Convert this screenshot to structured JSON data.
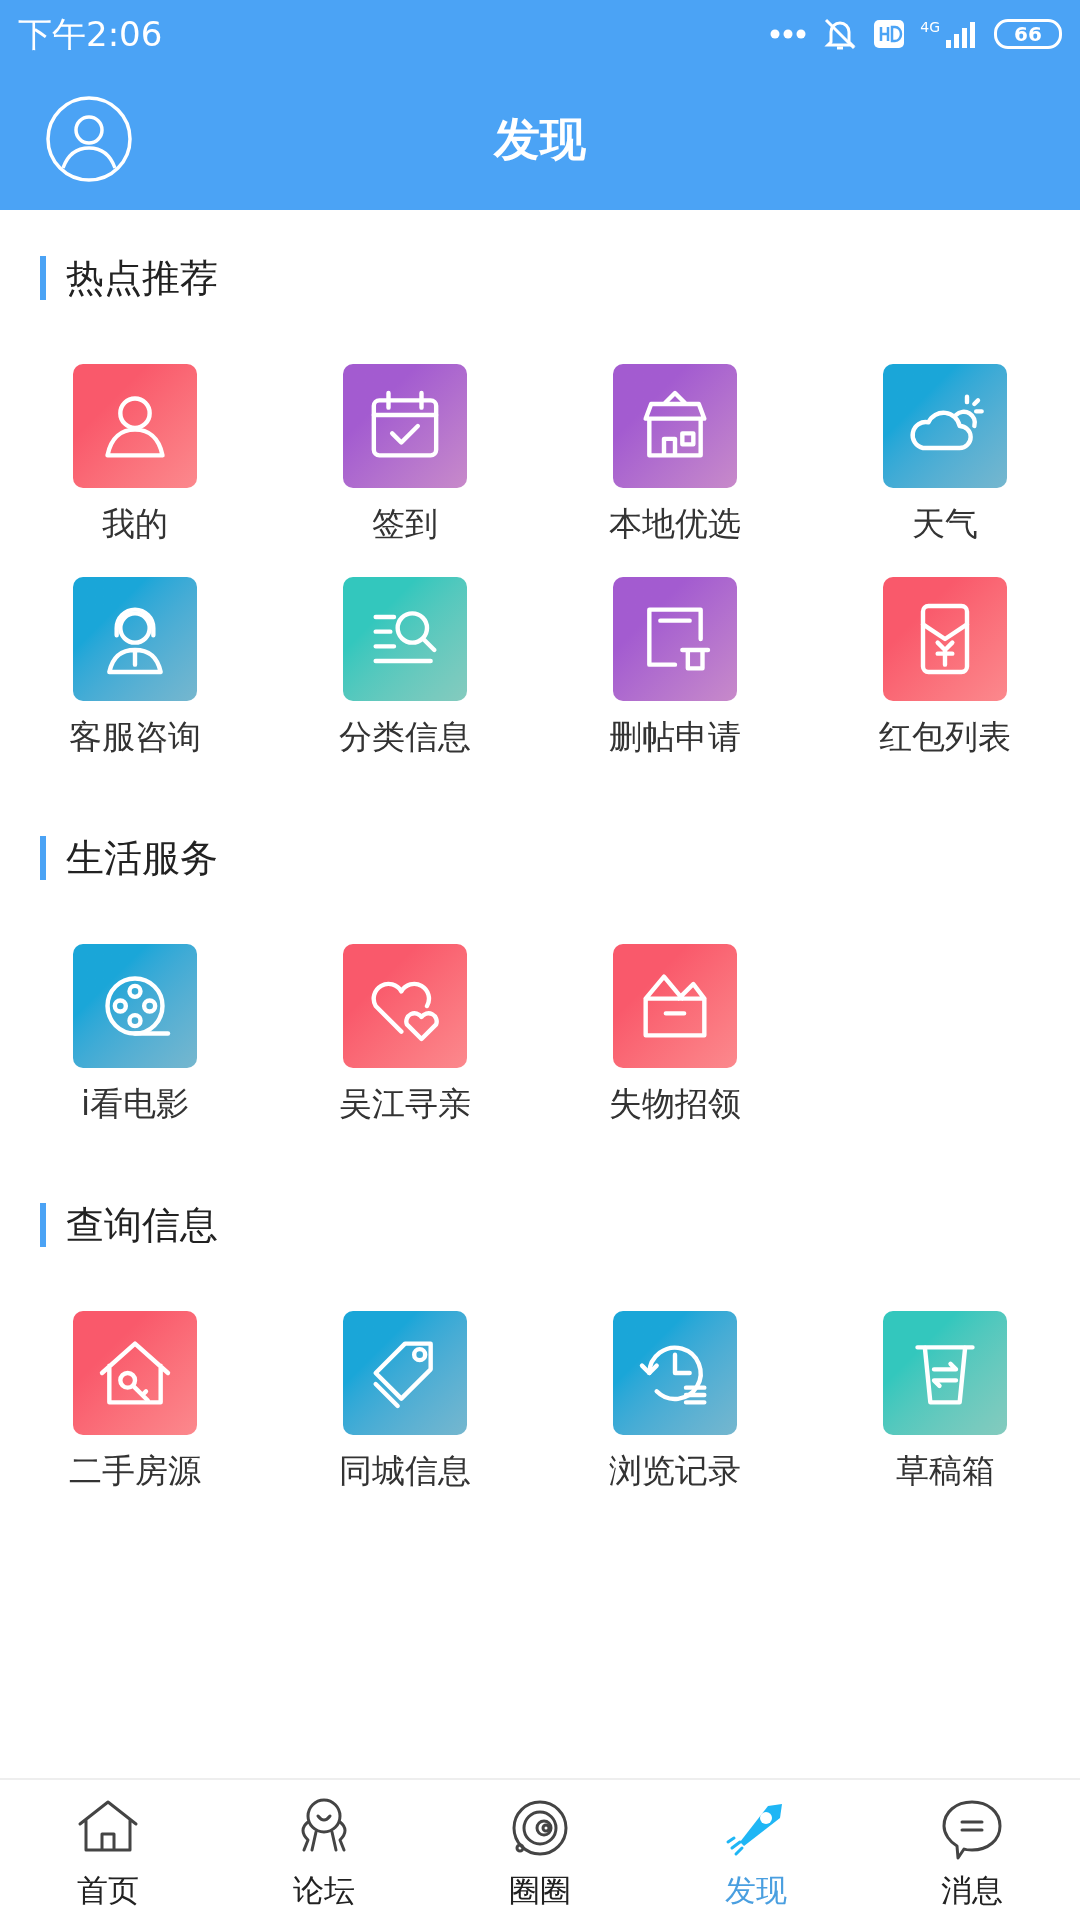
{
  "status_bar": {
    "time": "下午2:06",
    "network": "4G",
    "battery": "66"
  },
  "header": {
    "title": "发现"
  },
  "sections": [
    {
      "title": "热点推荐",
      "items": [
        {
          "label": "我的",
          "color": "#f9596b"
        },
        {
          "label": "签到",
          "color": "#a35bd0"
        },
        {
          "label": "本地优选",
          "color": "#a35bd0"
        },
        {
          "label": "天气",
          "color": "#1aa6d8"
        },
        {
          "label": "客服咨询",
          "color": "#1aa6d8"
        },
        {
          "label": "分类信息",
          "color": "#33c7bd"
        },
        {
          "label": "删帖申请",
          "color": "#a35bd0"
        },
        {
          "label": "红包列表",
          "color": "#f9596b"
        }
      ]
    },
    {
      "title": "生活服务",
      "items": [
        {
          "label": "i看电影",
          "color": "#1aa6d8"
        },
        {
          "label": "吴江寻亲",
          "color": "#f9596b"
        },
        {
          "label": "失物招领",
          "color": "#f9596b"
        }
      ]
    },
    {
      "title": "查询信息",
      "items": [
        {
          "label": "二手房源",
          "color": "#f9596b"
        },
        {
          "label": "同城信息",
          "color": "#1aa6d8"
        },
        {
          "label": "浏览记录",
          "color": "#1aa6d8"
        },
        {
          "label": "草稿箱",
          "color": "#33c7bd"
        }
      ]
    }
  ],
  "bottom_nav": [
    {
      "label": "首页",
      "selected": false
    },
    {
      "label": "论坛",
      "selected": false
    },
    {
      "label": "圈圈",
      "selected": false
    },
    {
      "label": "发现",
      "selected": true
    },
    {
      "label": "消息",
      "selected": false
    }
  ]
}
